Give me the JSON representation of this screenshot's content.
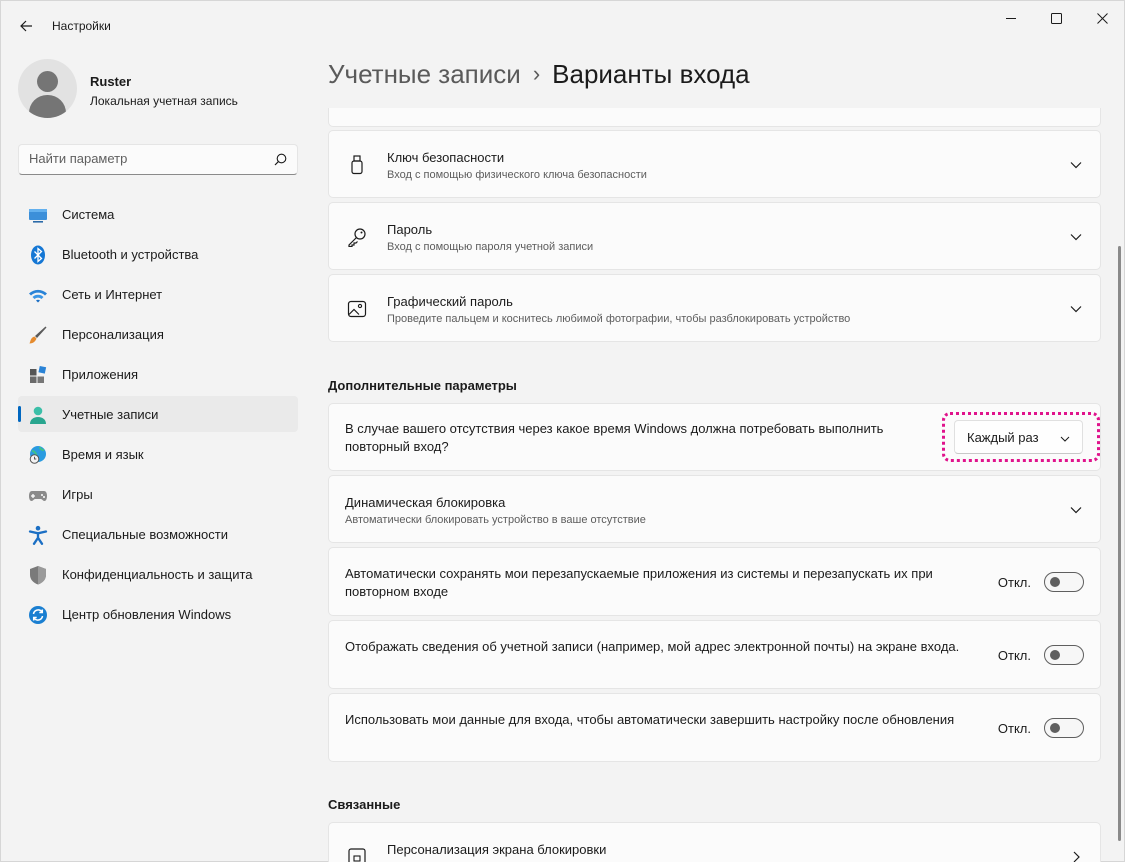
{
  "app": {
    "title": "Настройки"
  },
  "profile": {
    "name": "Ruster",
    "account_type": "Локальная учетная запись"
  },
  "search": {
    "placeholder": "Найти параметр"
  },
  "sidebar": {
    "items": [
      {
        "label": "Система",
        "icon": "system-icon"
      },
      {
        "label": "Bluetooth и устройства",
        "icon": "bluetooth-icon"
      },
      {
        "label": "Сеть и Интернет",
        "icon": "wifi-icon"
      },
      {
        "label": "Персонализация",
        "icon": "brush-icon"
      },
      {
        "label": "Приложения",
        "icon": "apps-icon"
      },
      {
        "label": "Учетные записи",
        "icon": "accounts-icon",
        "active": true
      },
      {
        "label": "Время и язык",
        "icon": "globe-clock-icon"
      },
      {
        "label": "Игры",
        "icon": "gamepad-icon"
      },
      {
        "label": "Специальные возможности",
        "icon": "accessibility-icon"
      },
      {
        "label": "Конфиденциальность и защита",
        "icon": "shield-icon"
      },
      {
        "label": "Центр обновления Windows",
        "icon": "update-icon"
      }
    ]
  },
  "breadcrumb": {
    "parent": "Учетные записи",
    "separator": "›",
    "current": "Варианты входа"
  },
  "signin_options": [
    {
      "title": "Ключ безопасности",
      "subtitle": "Вход с помощью физического ключа безопасности",
      "icon": "usb-key-icon"
    },
    {
      "title": "Пароль",
      "subtitle": "Вход с помощью пароля учетной записи",
      "icon": "key-icon"
    },
    {
      "title": "Графический пароль",
      "subtitle": "Проведите пальцем и коснитесь любимой фотографии, чтобы разблокировать устройство",
      "icon": "picture-icon"
    }
  ],
  "additional": {
    "heading": "Дополнительные параметры",
    "require_signin": {
      "text": "В случае вашего отсутствия через какое время Windows должна потребовать выполнить повторный вход?",
      "dropdown_value": "Каждый раз"
    },
    "dynamic_lock": {
      "title": "Динамическая блокировка",
      "subtitle": "Автоматически блокировать устройство в ваше отсутствие"
    },
    "toggles": [
      {
        "text": "Автоматически сохранять мои перезапускаемые приложения из системы и перезапускать их при повторном входе",
        "state": "Откл.",
        "on": false
      },
      {
        "text": "Отображать сведения об учетной записи (например, мой адрес электронной почты) на экране входа.",
        "state": "Откл.",
        "on": false
      },
      {
        "text": "Использовать мои данные для входа, чтобы автоматически завершить настройку после обновления",
        "state": "Откл.",
        "on": false
      }
    ]
  },
  "related": {
    "heading": "Связанные",
    "items": [
      {
        "title": "Персонализация экрана блокировки",
        "icon": "lock-screen-icon"
      }
    ]
  },
  "colors": {
    "accent": "#0067c0",
    "highlight_ring": "#e0138c",
    "background": "#f3f3f3",
    "card": "#fbfbfb"
  }
}
